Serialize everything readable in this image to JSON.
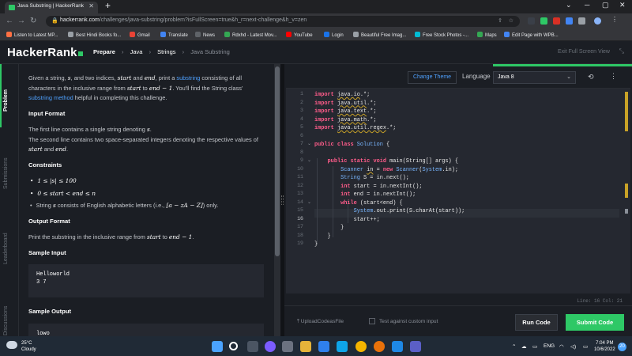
{
  "browser": {
    "tab_title": "Java Substring | HackerRank",
    "new_tab": "+",
    "url_host": "hackerrank.com",
    "url_path": "/challenges/java-substring/problem?isFullScreen=true&h_r=next-challenge&h_v=zen",
    "bookmarks": [
      "Listen to Latest MP...",
      "Best Hindi Books fo...",
      "Gmail",
      "Translate",
      "News",
      "Rdxhd - Latest Mov...",
      "YouTube",
      "Login",
      "Beautiful Free Imag...",
      "Free Stock Photos -...",
      "Maps",
      "Edit Page with WPB..."
    ]
  },
  "header": {
    "logo": "HackerRank",
    "breadcrumbs": [
      "Prepare",
      "Java",
      "Strings",
      "Java Substring"
    ],
    "exit_fullscreen": "Exit Full Screen View"
  },
  "side_tabs": [
    "Problem",
    "Submissions",
    "Leaderboard",
    "Discussions"
  ],
  "problem": {
    "intro_1": "Given a string, ",
    "var_s": "s",
    "intro_2": ", and two indices, ",
    "var_start": "start",
    "intro_3": " and ",
    "var_end": "end",
    "intro_4": ", print a ",
    "substring_link": "substring",
    "intro_5": " consisting of all characters in the inclusive range from ",
    "intro_6": " to ",
    "end_minus": "end − 1",
    "intro_7": ". You'll find the String class' ",
    "method_link": "substring method",
    "intro_8": " helpful in completing this challenge.",
    "input_format_title": "Input Format",
    "input_line1": "The first line contains a single string denoting ",
    "input_line2": "The second line contains two space-separated integers denoting the respective values of ",
    "constraints_title": "Constraints",
    "c1": "1 ≤ |s| ≤ 100",
    "c2": "0 ≤ start < end ≤ n",
    "c3_a": "String ",
    "c3_b": " consists of English alphabetic letters (i.e., ",
    "c3_range": "[a − zA − Z]",
    "c3_c": ") only.",
    "output_format_title": "Output Format",
    "output_line": "Print the substring in the inclusive range from ",
    "sample_input_title": "Sample Input",
    "sample_input": [
      "Helloworld",
      "3 7"
    ],
    "sample_output_title": "Sample Output",
    "sample_output": [
      "lowo"
    ]
  },
  "editor": {
    "change_theme": "Change Theme",
    "language_label": "Language",
    "language_value": "Java 8",
    "line_numbers": [
      "1",
      "2",
      "3",
      "4",
      "5",
      "6",
      "7",
      "8",
      "9",
      "10",
      "11",
      "12",
      "13",
      "14",
      "15",
      "16",
      "17",
      "18",
      "19"
    ],
    "status": "Line: 16 Col: 21",
    "upload": "UploadCodeasFile",
    "test_custom": "Test against custom input",
    "run_code": "Run Code",
    "submit_code": "Submit Code"
  },
  "taskbar": {
    "temperature": "25°C",
    "condition": "Cloudy",
    "language": "ENG",
    "time": "7:04 PM",
    "date": "10/6/2022",
    "notification_count": "20"
  },
  "colors": {
    "accent_green": "#2ec866",
    "link_blue": "#4ea1ff",
    "keyword_pink": "#ff5c8a",
    "type_blue": "#78b6ff"
  }
}
